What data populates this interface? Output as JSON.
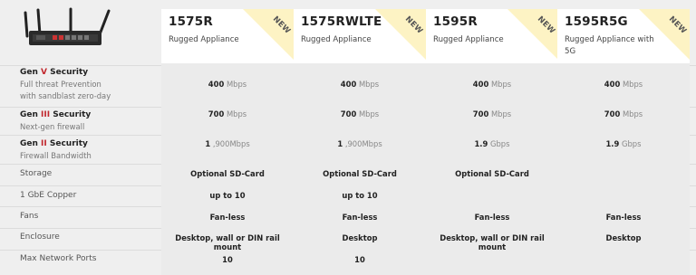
{
  "rows": {
    "gen5": {
      "gen": "Gen",
      "roman": "V",
      "title": "Security",
      "sub1": "Full threat Prevention",
      "sub2": "with sandblast zero-day"
    },
    "gen3": {
      "gen": "Gen",
      "roman": "III",
      "title": "Security",
      "sub1": "Next-gen firewall"
    },
    "gen2": {
      "gen": "Gen",
      "roman": "II",
      "title": "Security",
      "sub1": "Firewall Bandwidth"
    },
    "storage": "Storage",
    "copper": "1 GbE Copper",
    "fans": "Fans",
    "enclosure": "Enclosure",
    "ports": "Max Network Ports"
  },
  "products": [
    {
      "model": "1575R",
      "subtitle": "Rugged Appliance",
      "badge": "NEW",
      "gen5_val": "400",
      "gen5_unit": "Mbps",
      "gen3_val": "700",
      "gen3_unit": "Mbps",
      "gen2_val": "1",
      "gen2_unit": ",900Mbps",
      "storage": "Optional SD-Card",
      "copper": "up to 10",
      "fans": "Fan-less",
      "enclosure": "Desktop, wall or DIN rail mount",
      "ports": "10"
    },
    {
      "model": "1575RWLTE",
      "subtitle": "Rugged Appliance",
      "badge": "NEW",
      "gen5_val": "400",
      "gen5_unit": "Mbps",
      "gen3_val": "700",
      "gen3_unit": "Mbps",
      "gen2_val": "1",
      "gen2_unit": ",900Mbps",
      "storage": "Optional SD-Card",
      "copper": "up to 10",
      "fans": "Fan-less",
      "enclosure": "Desktop",
      "ports": "10"
    },
    {
      "model": "1595R",
      "subtitle": "Rugged Appliance",
      "badge": "NEW",
      "gen5_val": "400",
      "gen5_unit": "Mbps",
      "gen3_val": "700",
      "gen3_unit": "Mbps",
      "gen2_val": "1.9",
      "gen2_unit": "Gbps",
      "storage": "Optional SD-Card",
      "copper": "",
      "fans": "Fan-less",
      "enclosure": "Desktop, wall or DIN rail mount",
      "ports": ""
    },
    {
      "model": "1595R5G",
      "subtitle": "Rugged Appliance with 5G",
      "badge": "NEW",
      "gen5_val": "400",
      "gen5_unit": "Mbps",
      "gen3_val": "700",
      "gen3_unit": "Mbps",
      "gen2_val": "1.9",
      "gen2_unit": "Gbps",
      "storage": "",
      "copper": "",
      "fans": "Fan-less",
      "enclosure": "Desktop",
      "ports": ""
    }
  ],
  "colors": {
    "badge": "#fdf3c4",
    "roman": "#c1272d"
  }
}
